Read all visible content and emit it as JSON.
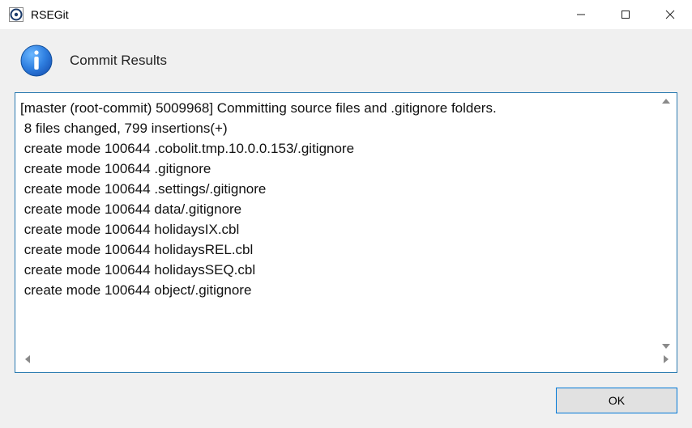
{
  "window": {
    "title": "RSEGit"
  },
  "dialog": {
    "title": "Commit Results",
    "output_lines": [
      "[master (root-commit) 5009968] Committing source files and .gitignore folders.",
      " 8 files changed, 799 insertions(+)",
      " create mode 100644 .cobolit.tmp.10.0.0.153/.gitignore",
      " create mode 100644 .gitignore",
      " create mode 100644 .settings/.gitignore",
      " create mode 100644 data/.gitignore",
      " create mode 100644 holidaysIX.cbl",
      " create mode 100644 holidaysREL.cbl",
      " create mode 100644 holidaysSEQ.cbl",
      " create mode 100644 object/.gitignore"
    ]
  },
  "buttons": {
    "ok_label": "OK"
  }
}
